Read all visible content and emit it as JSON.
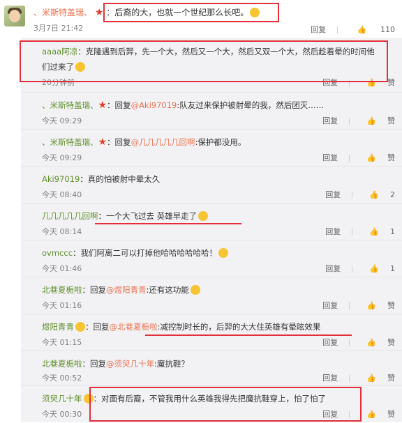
{
  "top": {
    "user": "、米斯特盖瑞、",
    "text": "：后裔的大，也就一个世纪那么长吧。",
    "date": "3月7日 21:42",
    "reply": "回复",
    "like_count": "110"
  },
  "comments": [
    {
      "user": "aaaa阿凉",
      "text": "：克隆遇到后羿，先一个大，然后又一个大，然后又双一个大，然后趁着晕的时间他",
      "text2": "们过来了",
      "time": "20分钟前",
      "reply": "回复",
      "like": "赞"
    },
    {
      "user": "、米斯特盖瑞、",
      "text": "：回复",
      "mention": "@Aki97019",
      "text3": ":队友过来保护被射晕的我，然后团灭……",
      "time": "今天 09:29",
      "reply": "回复",
      "like": "赞"
    },
    {
      "user": "、米斯特盖瑞、",
      "text": "：回复",
      "mention": "@几几几几几回啊",
      "text3": ":保护都没用。",
      "time": "今天 09:29",
      "reply": "回复",
      "like": "赞"
    },
    {
      "user": "Aki97019",
      "text": "：真的怕被射中晕太久",
      "time": "今天 08:40",
      "reply": "回复",
      "like": "2"
    },
    {
      "user": "几几几几几回啊",
      "text": "：一个大飞过去 英雄早走了",
      "time": "今天 08:14",
      "reply": "回复",
      "like": "1"
    },
    {
      "user": "ovmccc",
      "text": "：我们阿离二可以打掉他哈哈哈哈哈哈！",
      "time": "今天 01:46",
      "reply": "回复",
      "like": "1"
    },
    {
      "user": "北巷夏栀啦",
      "text": "：回复",
      "mention": "@煜阳青青",
      "text3": ":还有这功能",
      "time": "今天 01:16",
      "reply": "回复",
      "like": "赞"
    },
    {
      "user": "煜阳青青",
      "text": "：回复",
      "mention": "@北巷夏栀啦",
      "text3": ":减控制时长的，后羿的大大住英雄有晕眩效果",
      "time": "今天 01:15",
      "reply": "回复",
      "like": "赞"
    },
    {
      "user": "北巷夏栀啦",
      "text": "：回复",
      "mention": "@须臾几十年",
      "text3": ":魔抗鞋？",
      "time": "今天 00:52",
      "reply": "回复",
      "like": "赞"
    },
    {
      "user": "须臾几十年",
      "text": "：对面有后裔，不管我用什么英雄我得先把魔抗鞋穿上，怕了怕了",
      "time": "今天 00:30",
      "reply": "回复",
      "like": "赞"
    }
  ]
}
